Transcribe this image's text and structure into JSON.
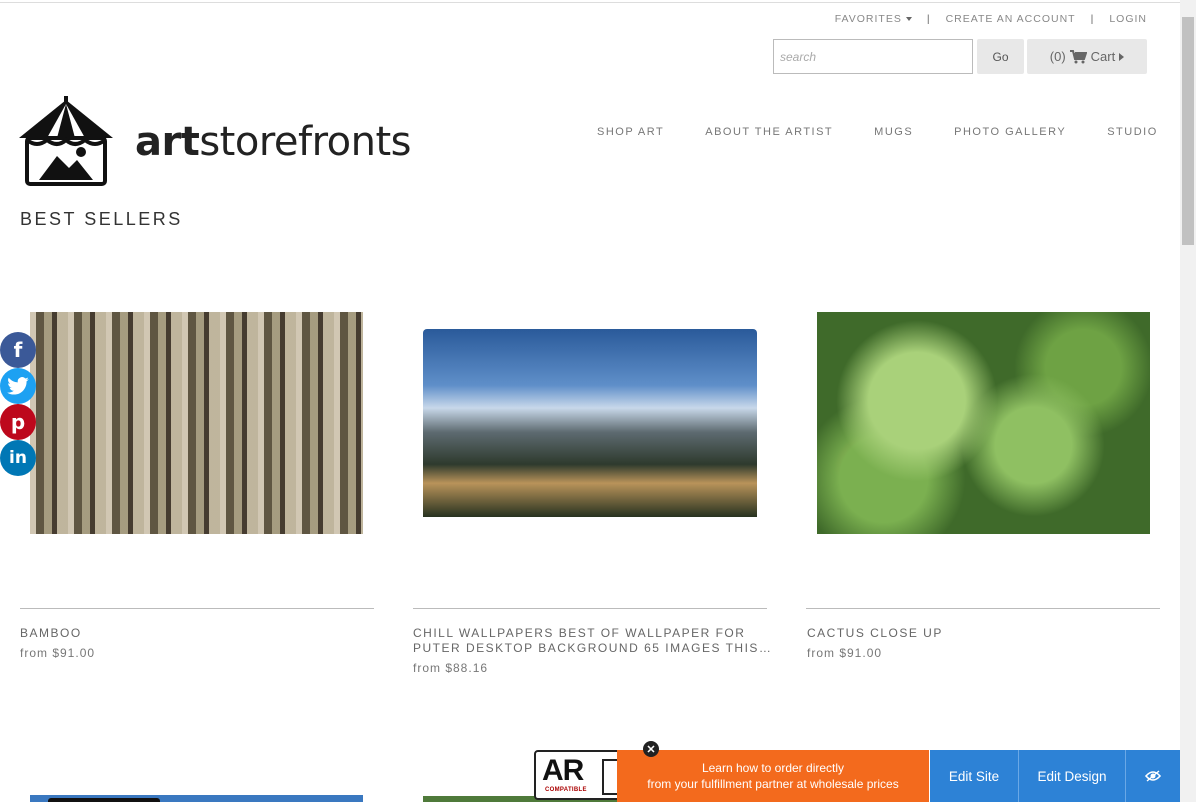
{
  "util_nav": {
    "favorites": "FAVORITES",
    "create_account": "CREATE AN ACCOUNT",
    "login": "LOGIN",
    "separator": "|"
  },
  "search": {
    "placeholder": "search",
    "go_label": "Go",
    "cart_count": "(0)",
    "cart_label": "Cart"
  },
  "logo": {
    "brand_bold": "art",
    "brand_rest": "storefronts"
  },
  "main_nav": [
    "SHOP ART",
    "ABOUT THE ARTIST",
    "MUGS",
    "PHOTO GALLERY",
    "STUDIO"
  ],
  "section_title": "BEST SELLERS",
  "products": [
    {
      "title": "BAMBOO",
      "price": "from $91.00"
    },
    {
      "title_line1": "CHILL WALLPAPERS BEST OF WALLPAPER FOR",
      "title_line2": "PUTER DESKTOP BACKGROUND 65 IMAGES THIS…",
      "price": "from $88.16"
    },
    {
      "title": "CACTUS CLOSE UP",
      "price": "from $91.00"
    }
  ],
  "share": {
    "facebook": "f",
    "twitter": "t",
    "pinterest": "p",
    "linkedin": "in"
  },
  "ar_badge": {
    "text": "AR",
    "sub": "COMPATIBLE"
  },
  "promo": {
    "line1": "Learn how to order directly",
    "line2": "from your fulfillment partner at wholesale prices"
  },
  "admin": {
    "edit_site": "Edit Site",
    "edit_design": "Edit Design"
  },
  "colors": {
    "promo": "#f36a1d",
    "admin": "#2d82d6",
    "facebook": "#3b5998",
    "twitter": "#1da1f2",
    "pinterest": "#bd081c",
    "linkedin": "#0077b5"
  }
}
